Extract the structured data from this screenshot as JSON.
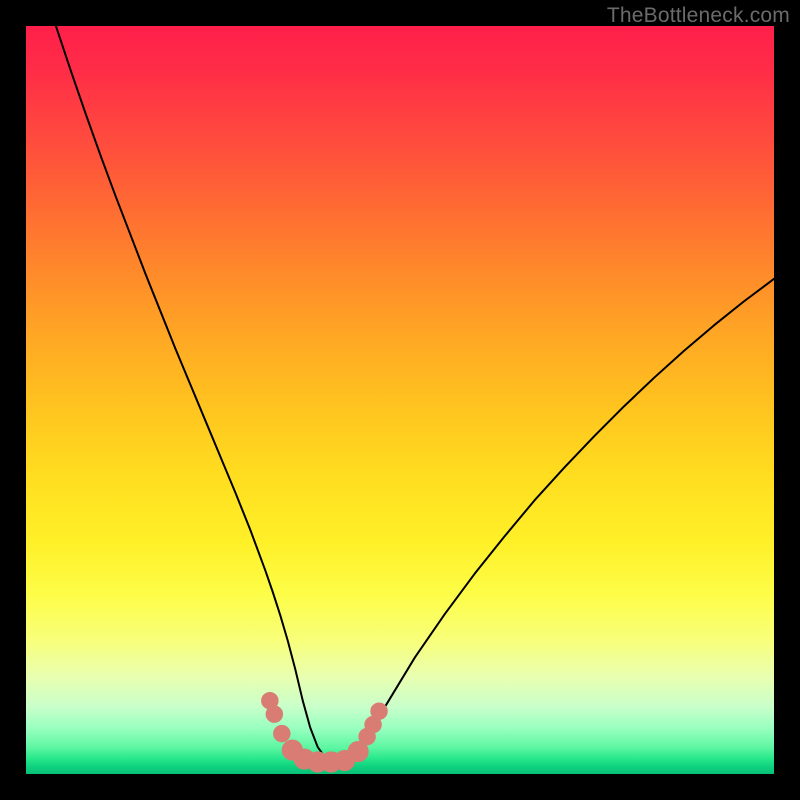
{
  "watermark": "TheBottleneck.com",
  "colors": {
    "frame": "#000000",
    "curve": "#000000",
    "marker_fill": "#d97c73",
    "marker_stroke": "#d97c73",
    "gradient_top": "#ff1f4a",
    "gradient_bottom": "#07c077"
  },
  "chart_data": {
    "type": "line",
    "title": "",
    "xlabel": "",
    "ylabel": "",
    "xlim": [
      0,
      100
    ],
    "ylim": [
      0,
      100
    ],
    "grid": false,
    "legend_position": "none",
    "series": [
      {
        "name": "bottleneck-curve",
        "x": [
          4,
          6,
          8,
          10,
          12,
          14,
          16,
          18,
          20,
          22,
          24,
          26,
          28,
          30,
          32,
          33,
          34,
          35,
          36,
          37,
          38,
          39,
          40,
          42,
          44,
          46,
          48,
          52,
          56,
          60,
          64,
          68,
          72,
          76,
          80,
          84,
          88,
          92,
          96,
          100
        ],
        "values": [
          100,
          94,
          88.2,
          82.6,
          77.2,
          72,
          66.8,
          61.8,
          56.8,
          52,
          47.2,
          42.4,
          37.6,
          32.6,
          27.2,
          24.3,
          21.2,
          17.8,
          14,
          9.8,
          6.2,
          3.6,
          2.2,
          1.6,
          2.6,
          5.4,
          9,
          15.6,
          21.4,
          26.8,
          31.8,
          36.6,
          41,
          45.2,
          49.2,
          53,
          56.6,
          60,
          63.2,
          66.2
        ]
      }
    ],
    "markers": [
      {
        "x": 32.6,
        "y": 9.8,
        "r": 1.1
      },
      {
        "x": 33.2,
        "y": 8.0,
        "r": 1.1
      },
      {
        "x": 34.2,
        "y": 5.4,
        "r": 1.1
      },
      {
        "x": 35.6,
        "y": 3.2,
        "r": 1.35
      },
      {
        "x": 37.2,
        "y": 2.0,
        "r": 1.35
      },
      {
        "x": 39.0,
        "y": 1.6,
        "r": 1.35
      },
      {
        "x": 40.8,
        "y": 1.6,
        "r": 1.35
      },
      {
        "x": 42.6,
        "y": 1.8,
        "r": 1.35
      },
      {
        "x": 44.4,
        "y": 3.0,
        "r": 1.35
      },
      {
        "x": 45.6,
        "y": 5.0,
        "r": 1.1
      },
      {
        "x": 46.4,
        "y": 6.6,
        "r": 1.1
      },
      {
        "x": 47.2,
        "y": 8.4,
        "r": 1.1
      }
    ]
  }
}
